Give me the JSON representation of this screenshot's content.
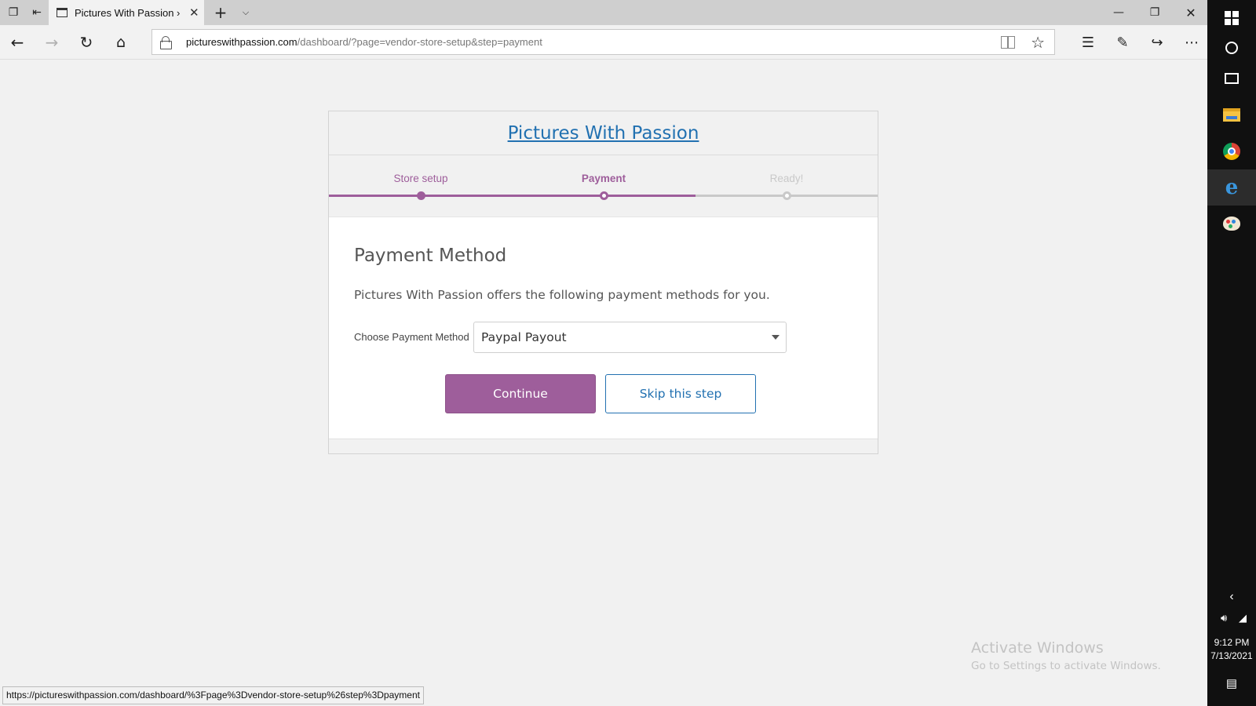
{
  "browser": {
    "tab_title": "Pictures With Passion › S",
    "url_host": "pictureswithpassion.com",
    "url_path": "/dashboard/?page=vendor-store-setup&step=payment",
    "status_url": "https://pictureswithpassion.com/dashboard/%3Fpage%3Dvendor-store-setup%26step%3Dpayment"
  },
  "site": {
    "title": "Pictures With Passion"
  },
  "wizard": {
    "steps": [
      {
        "label": "Store setup",
        "state": "done"
      },
      {
        "label": "Payment",
        "state": "current"
      },
      {
        "label": "Ready!",
        "state": "todo"
      }
    ],
    "accent_color": "#9e5e9b",
    "inactive_color": "#c9c9c9"
  },
  "payment": {
    "heading": "Payment Method",
    "description": "Pictures With Passion offers the following payment methods for you.",
    "field_label": "Choose Payment Method",
    "selected_method": "Paypal Payout",
    "continue_label": "Continue",
    "skip_label": "Skip this step"
  },
  "system": {
    "time": "9:12 PM",
    "date": "7/13/2021",
    "activate_title": "Activate Windows",
    "activate_sub": "Go to Settings to activate Windows."
  },
  "icons": {
    "tab_actions": [
      "tab-list-icon",
      "set-aside-tabs-icon"
    ],
    "nav": [
      "back-icon",
      "forward-icon",
      "refresh-icon",
      "home-icon"
    ],
    "toolbar": [
      "favorites-icon",
      "notes-icon",
      "share-icon",
      "more-icon"
    ],
    "taskbar": [
      "windows-start-icon",
      "cortana-icon",
      "task-view-icon",
      "file-explorer-icon",
      "chrome-icon",
      "edge-icon",
      "paint-icon"
    ]
  }
}
